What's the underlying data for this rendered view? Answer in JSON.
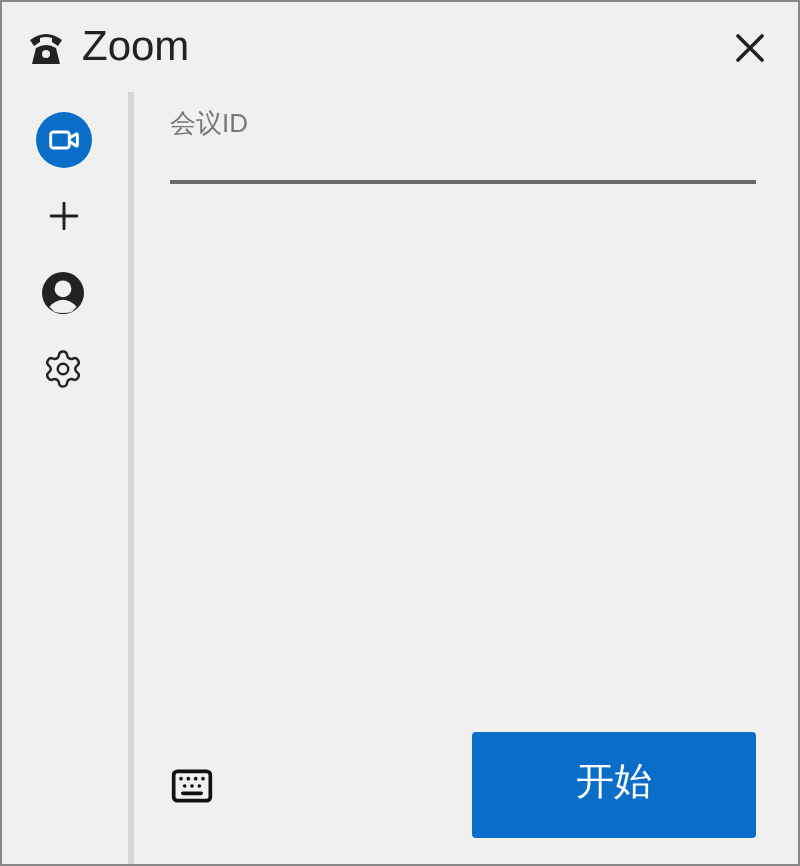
{
  "window": {
    "title": "Zoom"
  },
  "sidebar": {
    "items": [
      {
        "kind": "video",
        "selected": true
      },
      {
        "kind": "plus",
        "selected": false
      },
      {
        "kind": "person",
        "selected": false
      },
      {
        "kind": "gear",
        "selected": false
      }
    ]
  },
  "form": {
    "label": "会议ID",
    "button": "开始"
  }
}
